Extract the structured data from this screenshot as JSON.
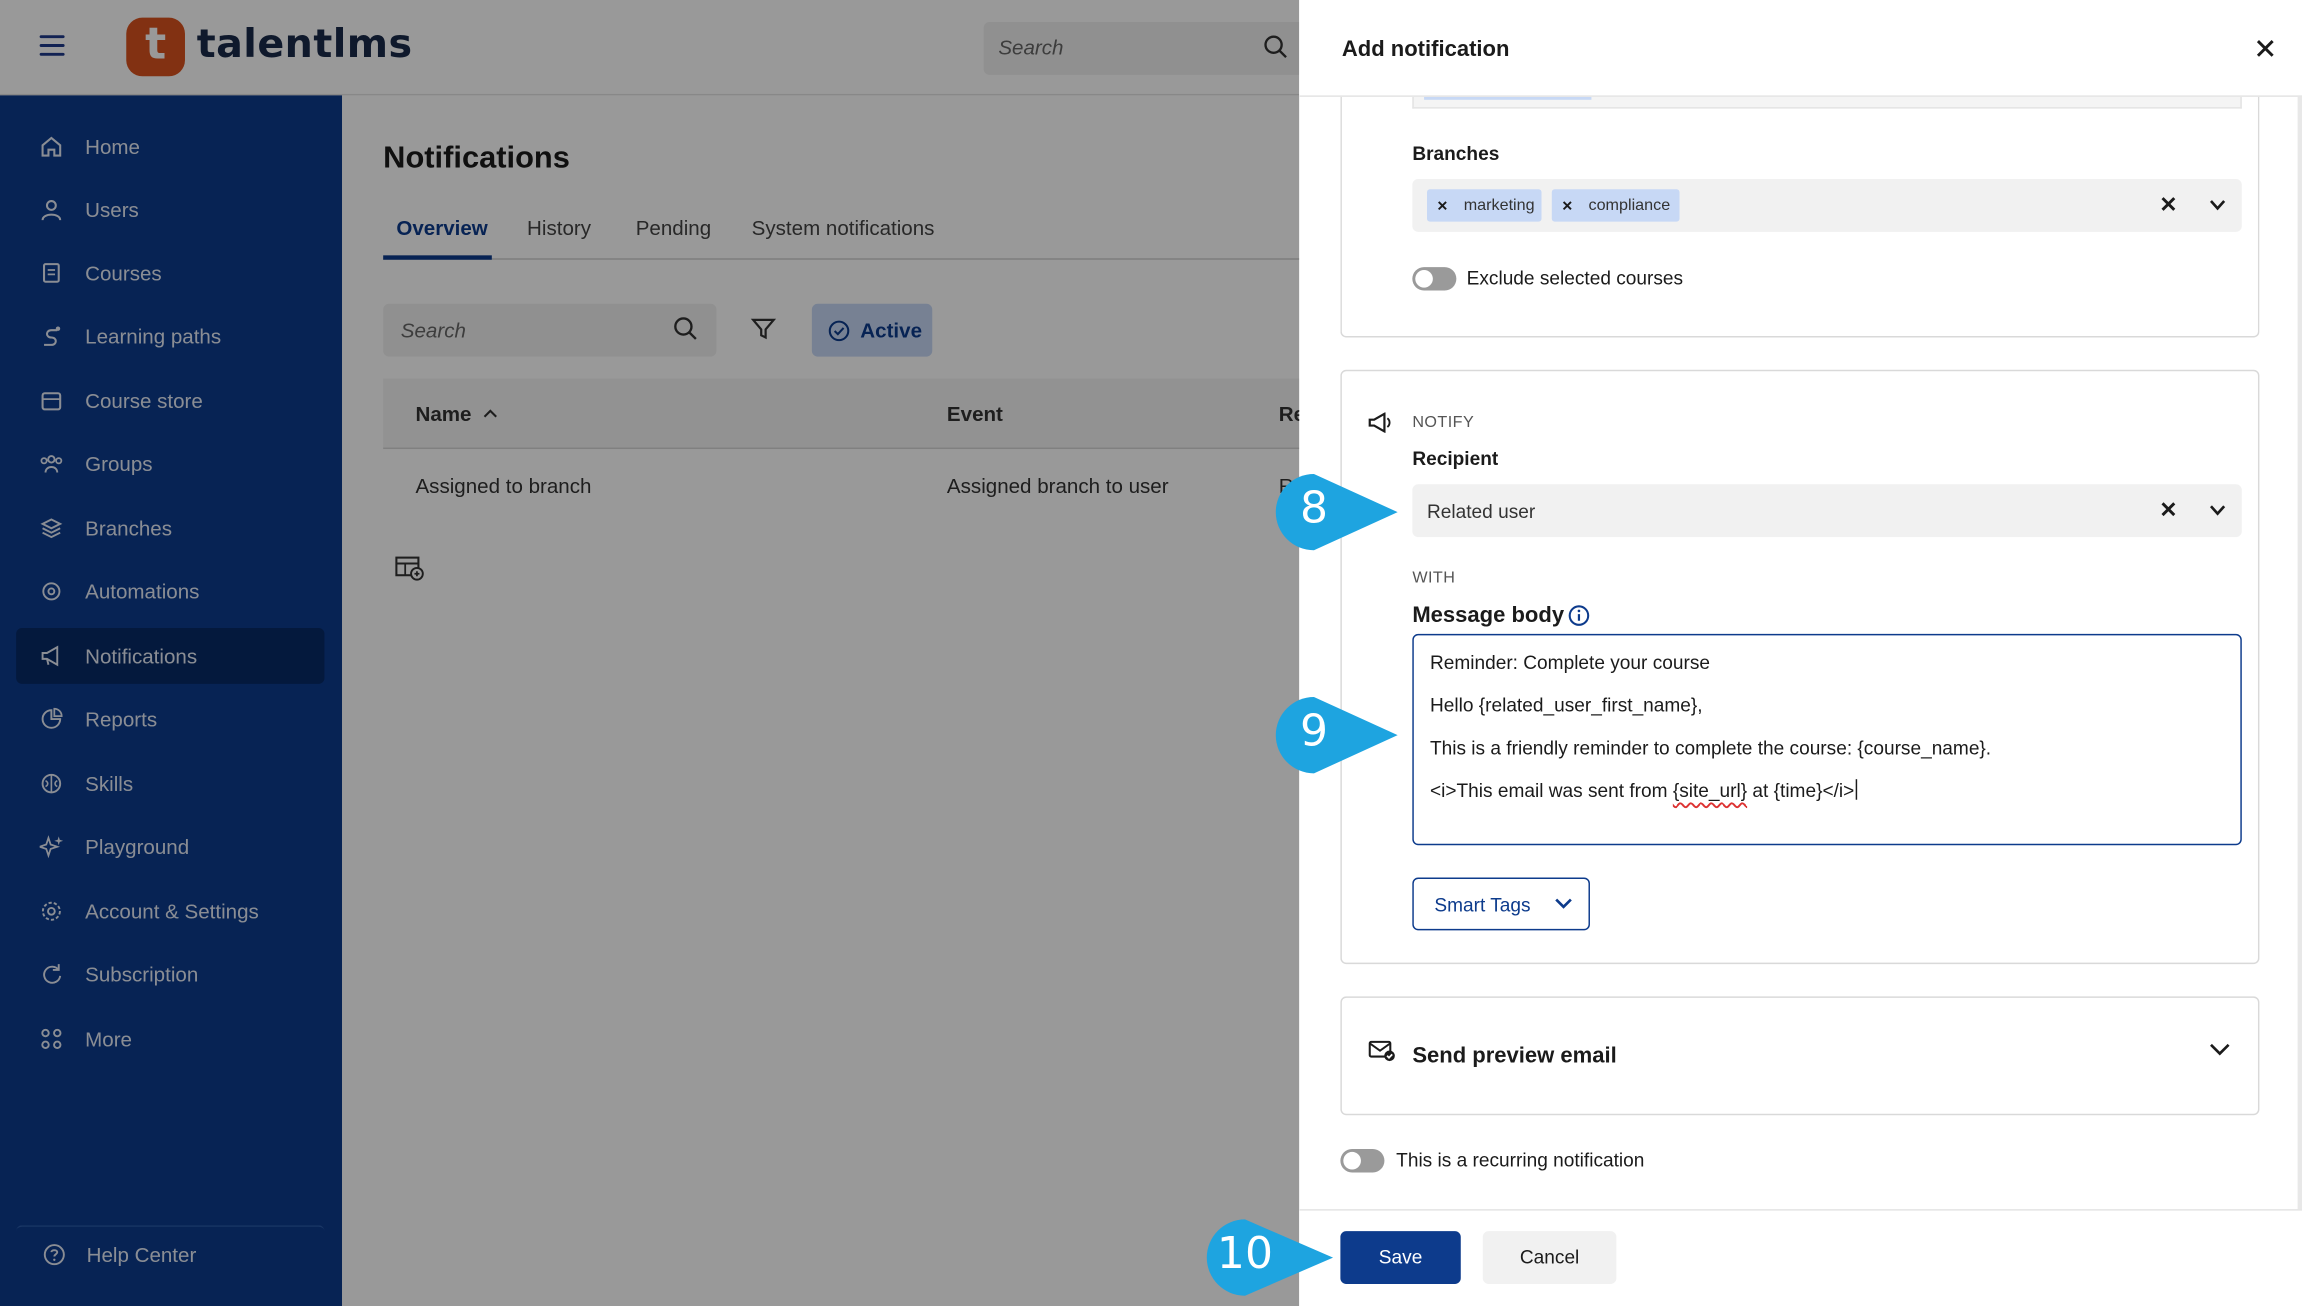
{
  "app": {
    "brand": "talentlms",
    "brand_letter": "t",
    "top_search_placeholder": "Search"
  },
  "sidebar": {
    "items": [
      {
        "label": "Home",
        "icon": "home-icon"
      },
      {
        "label": "Users",
        "icon": "user-icon"
      },
      {
        "label": "Courses",
        "icon": "book-icon"
      },
      {
        "label": "Learning paths",
        "icon": "path-icon"
      },
      {
        "label": "Course store",
        "icon": "store-icon"
      },
      {
        "label": "Groups",
        "icon": "groups-icon"
      },
      {
        "label": "Branches",
        "icon": "layers-icon"
      },
      {
        "label": "Automations",
        "icon": "automation-icon"
      },
      {
        "label": "Notifications",
        "icon": "megaphone-icon"
      },
      {
        "label": "Reports",
        "icon": "pie-chart-icon"
      },
      {
        "label": "Skills",
        "icon": "brain-icon"
      },
      {
        "label": "Playground",
        "icon": "sparkle-icon"
      },
      {
        "label": "Account & Settings",
        "icon": "gear-icon"
      },
      {
        "label": "Subscription",
        "icon": "refresh-icon"
      },
      {
        "label": "More",
        "icon": "grid-icon"
      }
    ],
    "active": "Notifications",
    "help": "Help Center"
  },
  "main": {
    "title": "Notifications",
    "tabs": [
      "Overview",
      "History",
      "Pending",
      "System notifications"
    ],
    "active_tab": "Overview",
    "search_placeholder": "Search",
    "active_filter": "Active",
    "table": {
      "columns": [
        "Name",
        "Event",
        "Re"
      ],
      "rows": [
        [
          "Assigned to branch",
          "Assigned branch to user",
          "Re"
        ]
      ]
    }
  },
  "drawer": {
    "title": "Add notification",
    "branches": {
      "label": "Branches",
      "chips": [
        "marketing",
        "compliance"
      ]
    },
    "exclude_label": "Exclude selected courses",
    "notify": {
      "section_label": "NOTIFY",
      "recipient_label": "Recipient",
      "recipient_value": "Related user",
      "with_label": "WITH",
      "message_label": "Message body",
      "message_lines": [
        "Reminder: Complete your course",
        "Hello {related_user_first_name},",
        "This is a friendly reminder to complete the course: {course_name}.",
        "<i>This email was sent from ",
        "{site_url}",
        " at {time}</i>"
      ],
      "smart_tags": "Smart Tags"
    },
    "preview": "Send preview email",
    "recurring": "This is a recurring notification",
    "save": "Save",
    "cancel": "Cancel"
  },
  "callouts": [
    "8",
    "9",
    "10"
  ],
  "colors": {
    "brand_orange": "#d9531e",
    "sidebar_blue": "#0d3b8c",
    "callout_blue": "#1ea4e0",
    "chip_blue": "#c7d8f5"
  }
}
